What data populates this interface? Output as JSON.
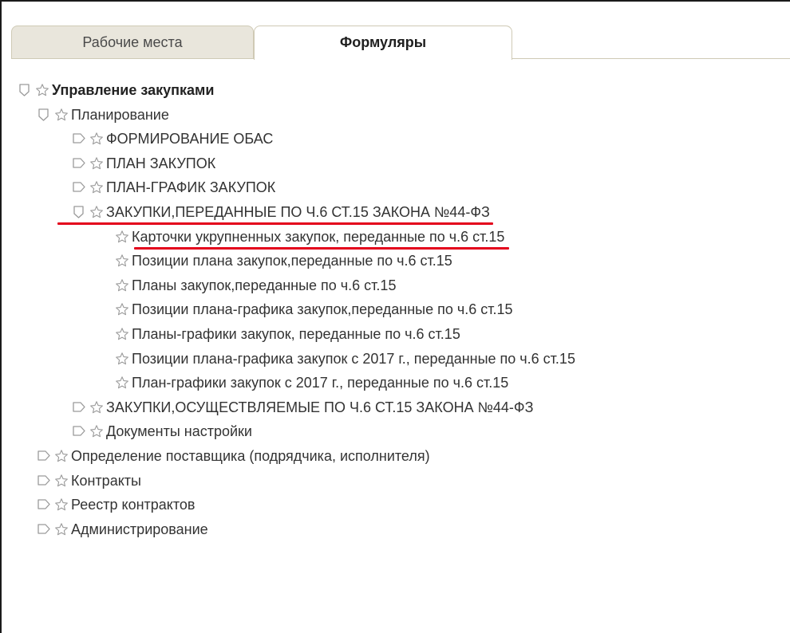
{
  "tabs": [
    {
      "label": "Рабочие места",
      "active": false
    },
    {
      "label": "Формуляры",
      "active": true
    }
  ],
  "tree": [
    {
      "label": "Управление закупками",
      "level": 0,
      "state": "expanded",
      "bold": true
    },
    {
      "label": "Планирование",
      "level": 1,
      "state": "expanded"
    },
    {
      "label": "ФОРМИРОВАНИЕ ОБАС",
      "level": 2,
      "state": "collapsed"
    },
    {
      "label": "ПЛАН ЗАКУПОК",
      "level": 2,
      "state": "collapsed"
    },
    {
      "label": "ПЛАН-ГРАФИК ЗАКУПОК",
      "level": 2,
      "state": "collapsed"
    },
    {
      "label": "ЗАКУПКИ,ПЕРЕДАННЫЕ ПО Ч.6 СТ.15 ЗАКОНА №44-ФЗ",
      "level": 2,
      "state": "expanded",
      "highlighted": true
    },
    {
      "label": "Карточки укрупненных закупок, переданные по ч.6 ст.15",
      "level": 3,
      "state": "leaf",
      "highlighted": true
    },
    {
      "label": "Позиции плана закупок,переданные по ч.6 ст.15",
      "level": 3,
      "state": "leaf"
    },
    {
      "label": "Планы закупок,переданные по ч.6 ст.15",
      "level": 3,
      "state": "leaf"
    },
    {
      "label": "Позиции плана-графика закупок,переданные по ч.6 ст.15",
      "level": 3,
      "state": "leaf"
    },
    {
      "label": "Планы-графики закупок, переданные по ч.6 ст.15",
      "level": 3,
      "state": "leaf"
    },
    {
      "label": "Позиции плана-графика закупок с 2017 г., переданные по ч.6 ст.15",
      "level": 3,
      "state": "leaf"
    },
    {
      "label": "План-графики закупок с 2017 г., переданные по ч.6 ст.15",
      "level": 3,
      "state": "leaf"
    },
    {
      "label": "ЗАКУПКИ,ОСУЩЕСТВЛЯЕМЫЕ ПО Ч.6 СТ.15 ЗАКОНА №44-ФЗ",
      "level": 2,
      "state": "collapsed"
    },
    {
      "label": "Документы настройки",
      "level": 2,
      "state": "collapsed"
    },
    {
      "label": "Определение поставщика (подрядчика, исполнителя)",
      "level": 1,
      "state": "collapsed"
    },
    {
      "label": "Контракты",
      "level": 1,
      "state": "collapsed"
    },
    {
      "label": "Реестр контрактов",
      "level": 1,
      "state": "collapsed"
    },
    {
      "label": "Администрирование",
      "level": 1,
      "state": "collapsed"
    }
  ],
  "icons": {
    "expanded": "expanded-toggle-icon",
    "collapsed": "collapsed-toggle-icon",
    "favorite": "star-icon"
  },
  "colors": {
    "highlight_underline": "#e3001b",
    "tab_inactive_bg": "#e9e6dc",
    "icon_stroke": "#9a9a9a"
  }
}
